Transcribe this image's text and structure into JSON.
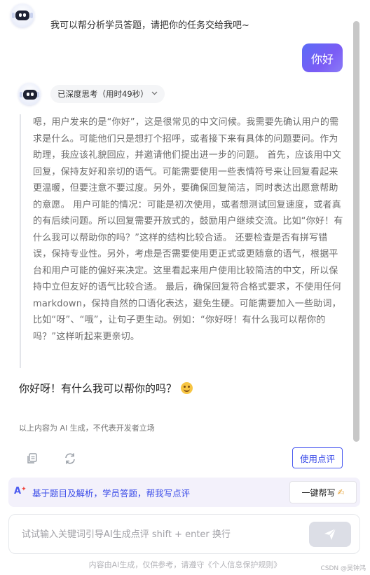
{
  "intro": {
    "message": "我可以帮分析学员答题，请把你的任务交给我吧~"
  },
  "user_message": "你好",
  "thinking": {
    "label": "已深度思考（用时49秒）",
    "content": "嗯，用户发来的是“你好”，这是很常见的中文问候。我需要先确认用户的需求是什么。可能他们只是想打个招呼，或者接下来有具体的问题要问。作为助理，我应该礼貌回应，并邀请他们提出进一步的问题。 首先，应该用中文回复，保持友好和亲切的语气。可能需要使用一些表情符号来让回复看起来更温暖，但要注意不要过度。另外，要确保回复简洁，同时表达出愿意帮助的意愿。 用户可能的情况：可能是初次使用，或者想测试回复速度，或者真的有后续问题。所以回复需要开放式的，鼓励用户继续交流。比如“你好！有什么我可以帮助你的吗？”这样的结构比较合适。 还要检查是否有拼写错误，保持专业性。另外，考虑是否需要使用更正式或更随意的语气，根据平台和用户可能的偏好来决定。这里看起来用户使用比较简洁的中文，所以保持中立但友好的语气比较合适。 最后，确保回复符合格式要求，不使用任何markdown，保持自然的口语化表达，避免生硬。可能需要加入一些助词，比如“呀”、“哦”，让句子更生动。例如：“你好呀！有什么我可以帮你的吗？”这样听起来更亲切。"
  },
  "answer": {
    "text": "你好呀！有什么我可以帮你的吗？",
    "emoji": "smiling-face-icon"
  },
  "disclaimer": "以上内容为 AI 生成，不代表开发者立场",
  "actions": {
    "use_review_label": "使用点评"
  },
  "suggest": {
    "icon": "ai-logo-icon",
    "items": [
      "基于题目及解析",
      "学员答题",
      "帮我写点评"
    ],
    "sep1": "，",
    "sep2": "，",
    "quick_help_label": "一键帮写",
    "quick_help_emoji": "✍"
  },
  "input": {
    "placeholder": "试试输入关键词引导AI生成点评 shift + enter 换行",
    "value": ""
  },
  "footer": {
    "note": "内容由AI生成，仅供参考，请遵守《个人信息保护规则》",
    "watermark": "CSDN @吴钟鸿"
  },
  "colors": {
    "accent": "#4b5bf0",
    "user_bubble_start": "#5a6cf6",
    "user_bubble_end": "#8a7bf7",
    "suggest_bg": "#f3f1fb"
  }
}
